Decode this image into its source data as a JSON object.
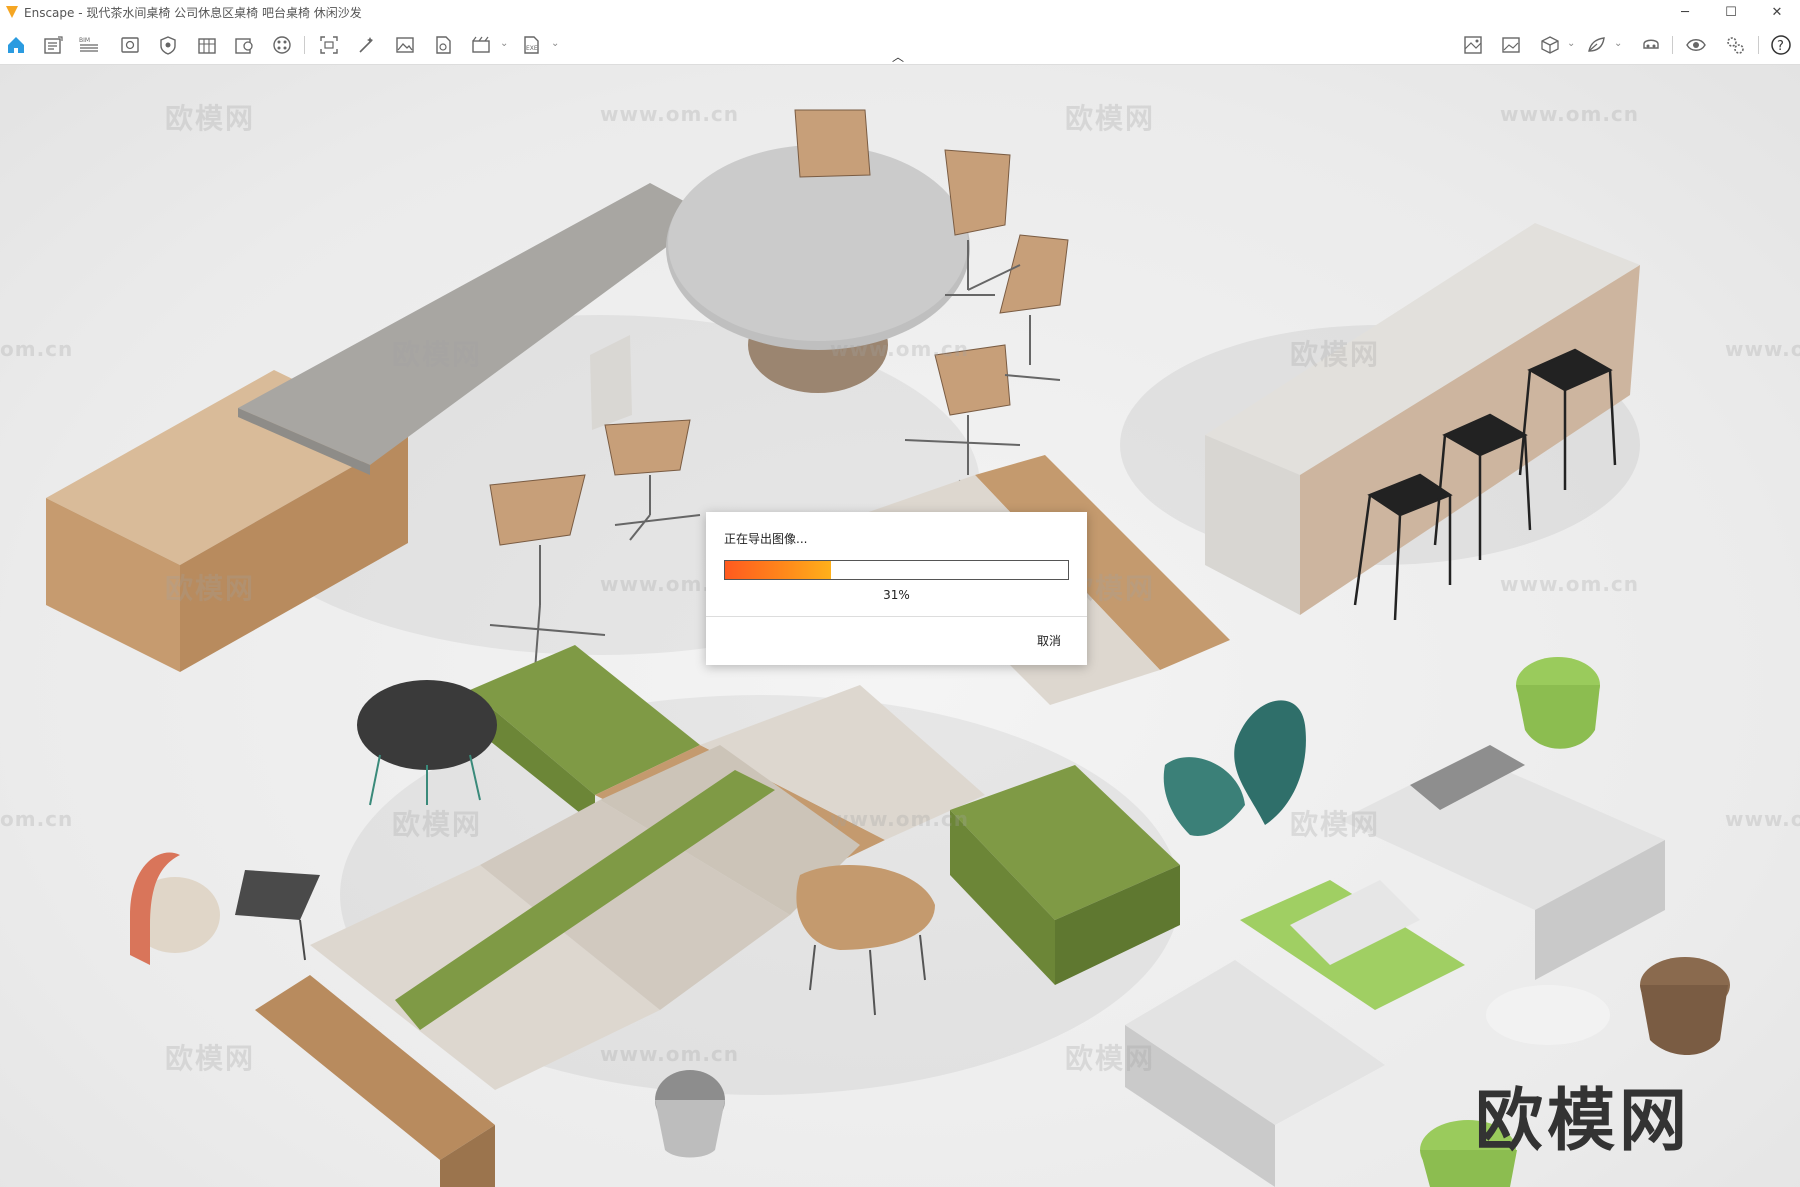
{
  "window": {
    "app_name": "Enscape",
    "title": "Enscape - 现代茶水间桌椅 公司休息区桌椅 吧台桌椅 休闲沙发",
    "minimize": "─",
    "maximize": "☐",
    "close": "✕"
  },
  "toolbar": {
    "left_icons": [
      "home-icon",
      "views-icon",
      "bim-icon",
      "visual-settings-icon",
      "safe-frame-icon",
      "asset-library-icon",
      "site-context-icon",
      "material-editor-icon",
      "screenshot-icon",
      "batch-render-icon",
      "image-export-icon",
      "panorama-icon",
      "video-editor-icon",
      "export-icon"
    ],
    "right_icons": [
      "atmosphere-icon",
      "image-settings-icon",
      "cube-icon",
      "vr-icon",
      "vr-headset-icon",
      "eye-icon",
      "settings-icon",
      "help-icon"
    ],
    "help_label": "?"
  },
  "scene": {
    "watermark_brand": "欧模网",
    "watermark_url": "www.om.cn",
    "watermark_url_partial": "om.cn",
    "watermark_url_partial_right": "www.o",
    "big_watermark": "欧模网"
  },
  "export_dialog": {
    "title": "正在导出图像...",
    "progress": 0.31,
    "progress_label": "31%",
    "cancel_label": "取消",
    "accent_color": "#ff8c1a"
  }
}
